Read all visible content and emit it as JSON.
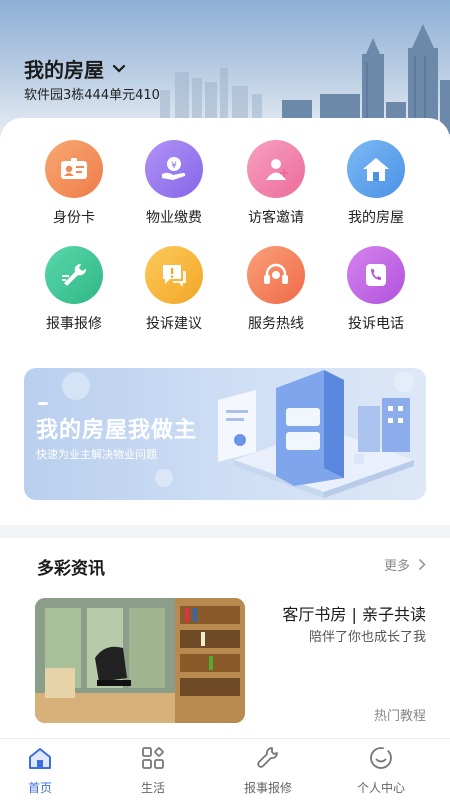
{
  "header": {
    "house_title": "我的房屋",
    "address": "软件园3栋444单元410"
  },
  "grid": [
    {
      "label": "身份卡",
      "icon": "id-card-icon",
      "color": "#f3935e"
    },
    {
      "label": "物业缴费",
      "icon": "payment-icon",
      "color": "#9a7cf0"
    },
    {
      "label": "访客邀请",
      "icon": "visitor-icon",
      "color": "#f07fa8"
    },
    {
      "label": "我的房屋",
      "icon": "house-icon",
      "color": "#5ea6ef"
    },
    {
      "label": "报事报修",
      "icon": "wrench-icon",
      "color": "#3fc79a"
    },
    {
      "label": "投诉建议",
      "icon": "feedback-icon",
      "color": "#f6b53c"
    },
    {
      "label": "服务热线",
      "icon": "headset-icon",
      "color": "#f5805d"
    },
    {
      "label": "投诉电话",
      "icon": "phone-icon",
      "color": "#c264e0"
    }
  ],
  "banner": {
    "title": "我的房屋我做主",
    "subtitle": "快速为业主解决物业问题"
  },
  "news": {
    "section_title": "多彩资讯",
    "more_label": "更多",
    "article_title": "客厅书房 | 亲子共读",
    "article_subtitle": "陪伴了你也成长了我",
    "article_tag": "热门教程"
  },
  "tabs": [
    {
      "label": "首页",
      "icon": "home-icon",
      "active": true
    },
    {
      "label": "生活",
      "icon": "grid-icon",
      "active": false
    },
    {
      "label": "报事报修",
      "icon": "wrench-icon",
      "active": false
    },
    {
      "label": "个人中心",
      "icon": "profile-icon",
      "active": false
    }
  ],
  "colors": {
    "accent": "#3b6fe0",
    "banner_bg": "#c6d9f2"
  }
}
